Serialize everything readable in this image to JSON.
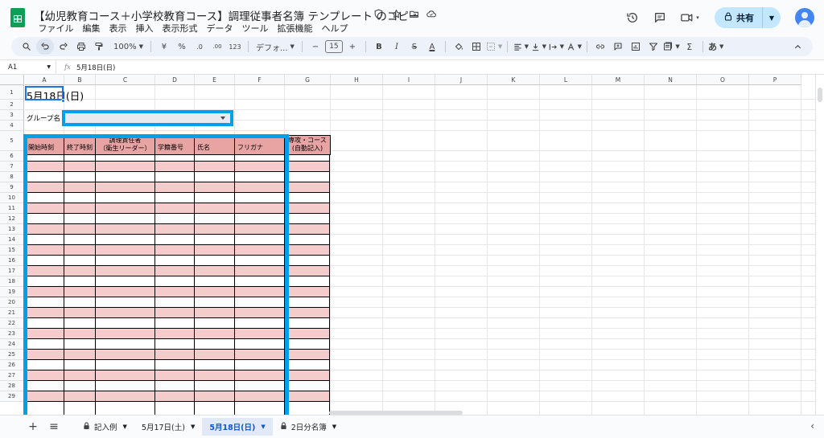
{
  "app": {
    "doc_title": "【幼児教育コース＋小学校教育コース】調理従事者名簿 テンプレート のコピー",
    "menu": [
      "ファイル",
      "編集",
      "表示",
      "挿入",
      "表示形式",
      "データ",
      "ツール",
      "拡張機能",
      "ヘルプ"
    ],
    "share_label": "共有",
    "accent": "#00a0e9",
    "header_pink": "#e8a3a3",
    "row_pink": "#f4cccc"
  },
  "toolbar": {
    "zoom": "100%",
    "currency": "¥",
    "percent": "%",
    "dec_decrease": ".0",
    "dec_increase": ".00",
    "number_format": "123",
    "font": "デフォ...",
    "font_size": "15",
    "bold": "B",
    "italic": "I",
    "strike": "S",
    "text_color": "A",
    "functions": "Σ",
    "input_tools": "あ"
  },
  "formula_bar": {
    "cell_ref": "A1",
    "fx": "fx",
    "content": "5月18日(日)"
  },
  "grid": {
    "columns": [
      "A",
      "B",
      "C",
      "D",
      "E",
      "F",
      "G",
      "H",
      "I",
      "J",
      "K",
      "L",
      "M",
      "N",
      "O",
      "P"
    ],
    "rows": [
      "1",
      "2",
      "3",
      "4",
      "5",
      "6",
      "7",
      "8",
      "9",
      "10",
      "11",
      "12",
      "13",
      "14",
      "15",
      "16",
      "17",
      "18",
      "19",
      "20",
      "21",
      "22",
      "23",
      "24",
      "25",
      "26",
      "27",
      "28",
      "29"
    ],
    "a1_value": "5月18日(日)",
    "group_label": "グループ名",
    "table_headers": {
      "start_time": "開始時刻",
      "end_time": "終了時刻",
      "leader_line1": "調理責任者",
      "leader_line2": "（衛生リーダー）",
      "student_no": "学籍番号",
      "name": "氏名",
      "furigana": "フリガナ",
      "course_line1": "専攻・コース",
      "course_line2": "(自動記入)"
    }
  },
  "sheets": {
    "tabs": [
      {
        "label": "記入例",
        "locked": true,
        "active": false
      },
      {
        "label": "5月17日(土)",
        "locked": false,
        "active": false
      },
      {
        "label": "5月18日(日)",
        "locked": false,
        "active": true
      },
      {
        "label": "2日分名簿",
        "locked": true,
        "active": false
      }
    ]
  }
}
